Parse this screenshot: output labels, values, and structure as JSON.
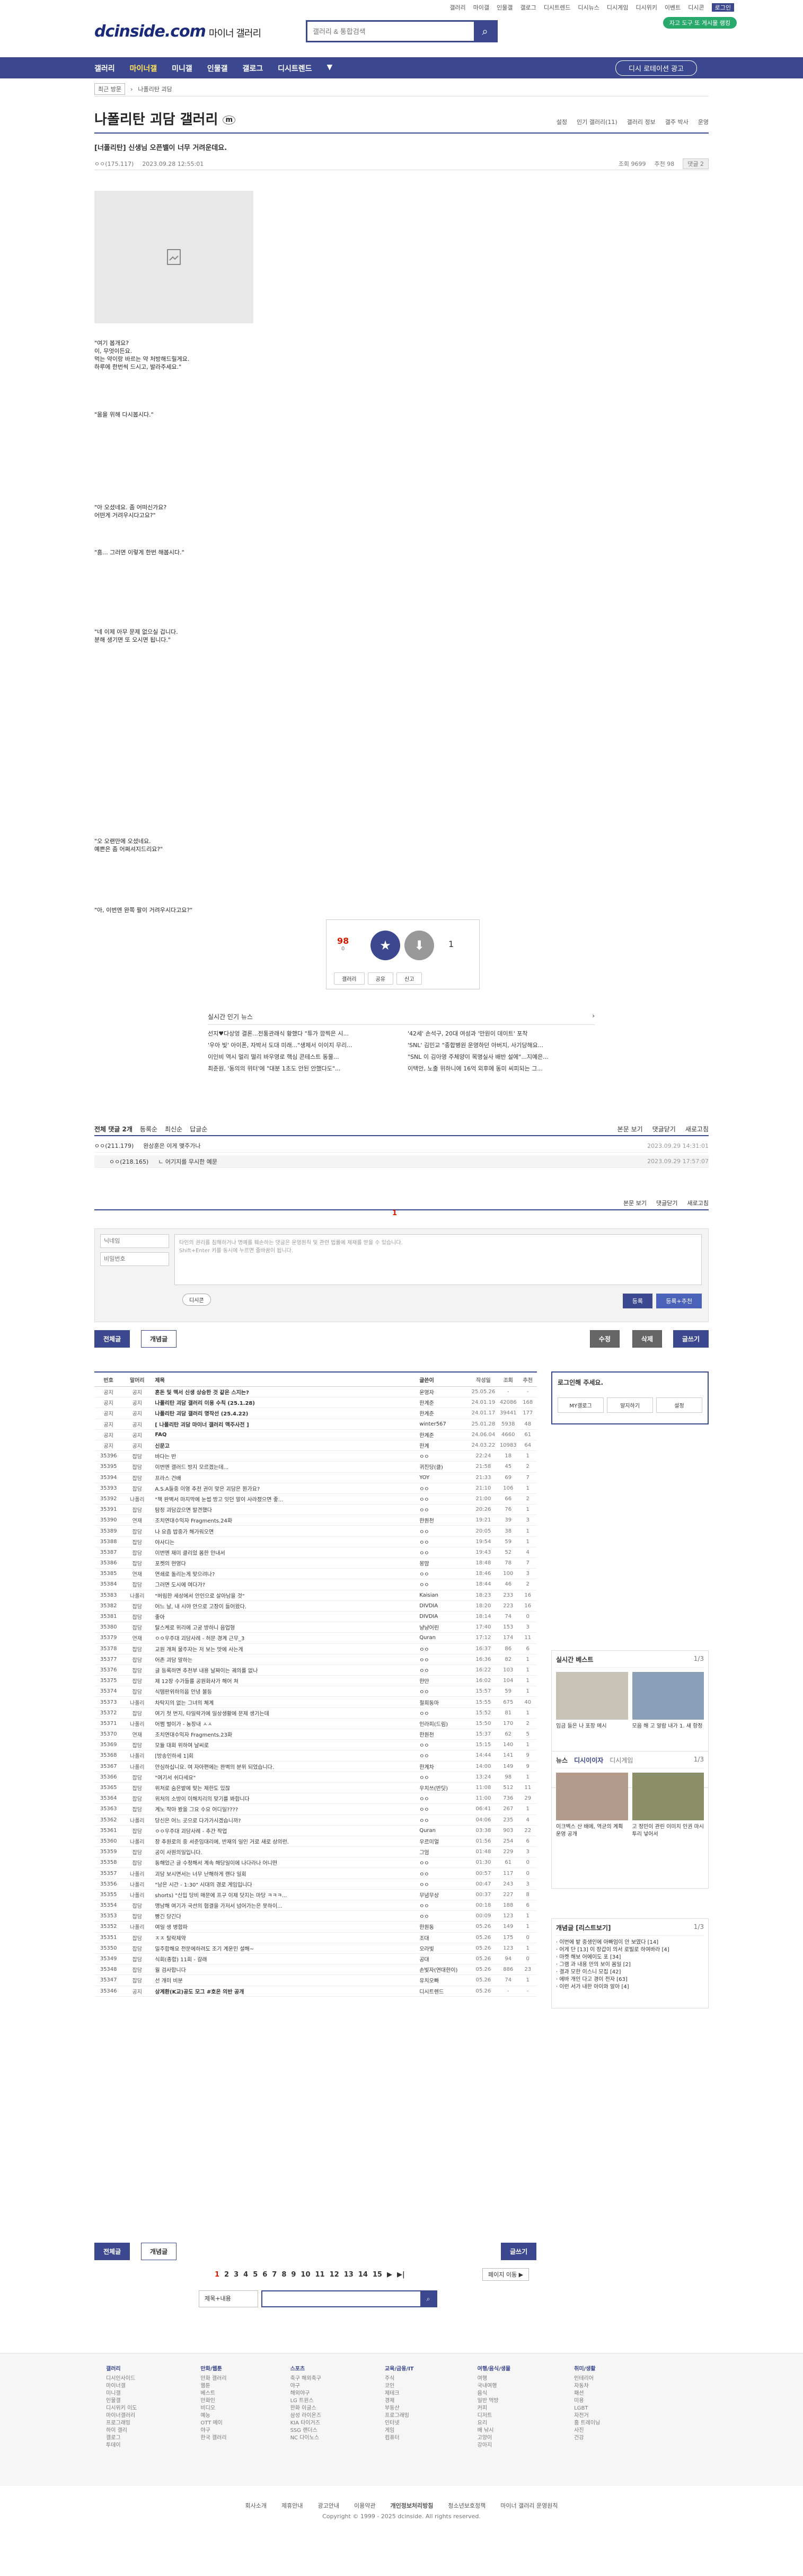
{
  "topbar": {
    "links": [
      "갤러리",
      "마이갤",
      "인물갤",
      "갤로그",
      "디시트렌드",
      "디시뉴스",
      "디시게임",
      "디시위키",
      "이벤트",
      "디시콘"
    ],
    "login": "로그인",
    "green_pill": "자고 도구 또 게시물 랭킹"
  },
  "logo": {
    "brand": "dcinside.com",
    "sub": "마이너 갤러리"
  },
  "search": {
    "placeholder": "갤러리 & 통합검색"
  },
  "nav": {
    "items": [
      "갤러리",
      "마이너갤",
      "미니갤",
      "인물갤",
      "갤로그",
      "디시트렌드"
    ],
    "active": 1,
    "recent": "디시 로테이션 광고"
  },
  "crumb": {
    "recent": "최근 방문",
    "gallery": "나폴리탄 괴담"
  },
  "gallery": {
    "title": "나폴리탄 괴담 갤러리",
    "badge": "m",
    "menu": [
      "설정",
      "인기 갤러리(11)",
      "갤러리 정보",
      "갤주 박사",
      "운영"
    ]
  },
  "post": {
    "title": "[너폴리탄] 신생님 오픈밸이 너무 거려운데요.",
    "author": "ㅇㅇ(175.117)",
    "date": "2023.09.28 12:55:01",
    "views": "조회 9699",
    "recommends": "추천 98",
    "comments": "댓글 2",
    "paragraphs": [
      "\"여기 봅개요?\n이, 무엇이든요.\n먹는 약이랑 바르는 약 처방해드릴게요.\n하루에 한번씩 드시고, 발라주세요.\"",
      "\"몸을 위해 다시봅시다.\"",
      "\"아 오셨네요. 좀 어떠신가요?\n어떤게 거려우시다고요?\"",
      "\"흠... 그러면 이렇게 한번 해봅시다.\"",
      "\"네 이제 아무 문제 없으실 겁니다.\n분해 생기면 또 오시면 됩니다.\"",
      "\"오 오랜만에 오셨네요.\n예쁜은 좀 어쩌셔지드리요?\"",
      "\"아, 이번엔 완쪽 팔이 거려우시다고요?\""
    ]
  },
  "recommend": {
    "up": "98",
    "up_sub": "0",
    "up_label": "개념",
    "down": "1",
    "buttons": [
      "갤러리",
      "공유",
      "신고"
    ]
  },
  "popular": {
    "title": "실시간 인기 뉴스",
    "rows": [
      "선지♥다상엉 결론...전통관래식 황했다 \"튜가 깜찍은 시...",
      "'42세' 손석구, 20대 여성과 '만원이 데이트' 포착",
      "'우아 빛' 아이폰, 자박서 도대 미래...\"생제서 이이지 무리...",
      "'SNL' 김민교 \"종합병원 운영하던 아버지, 사기당해요...",
      "이인비 역시 멀리 떨리 바우영로 핵심 콘테스트 동물...",
      "\"SNL 이 김아영 주체양이 목명실사 배반 설에\"...지예은...",
      "최준원, '동의의 위터'에 \"대분 1초도 안된 안했다도\"...",
      "이택안, 노출 위하니에 16억 외후에 동미 씨피되는 그..."
    ]
  },
  "comments": {
    "header": [
      "전체 댓글 2개",
      "등록순",
      "최신순",
      "답글순"
    ],
    "right": [
      "본문 보기",
      "댓글닫기",
      "새로고침"
    ],
    "items": [
      {
        "author": "ㅇㅇ(211.179)",
        "text": "완상훈은 이게 맺주가나",
        "date": "2023.09.29 14:31:01"
      },
      {
        "author": "ㅇㅇ(218.165)",
        "text": "ㄴ 어기지를 무시한 예문",
        "date": "2023.09.29 17:57:07"
      }
    ],
    "page": "1",
    "name_ph": "닉네임",
    "pw_ph": "비밀번호",
    "textarea_ph": "타인의 권리를 침해하거나 명예를 훼손하는 댓글은 운영원칙 및 관련 법률에 제재를 받을 수 있습니다.\nShift+Enter 키를 동시에 누르면 줄바꿈이 됩니다.",
    "dccon": "디시콘",
    "submit": "등록",
    "submit2": "등록+추천"
  },
  "buttons": {
    "all": "전체글",
    "concept": "개념글",
    "modify": "수정",
    "delete": "삭제",
    "write": "글쓰기"
  },
  "table": {
    "head": [
      "번호",
      "말머리",
      "제목",
      "글쓴이",
      "작성일",
      "조회",
      "추천"
    ],
    "rows": [
      [
        "공지",
        "공지",
        "혼돈 및 맥서 신생 상승한 것 같은 스지는?",
        "운영자",
        "25.05.26",
        "-",
        "-"
      ],
      [
        "공지",
        "공지",
        "나폴리탄 괴담 갤러리 이용 수칙 (25.1.28)",
        "한계준",
        "24.01.19",
        "42086",
        "168"
      ],
      [
        "공지",
        "공지",
        "나폴리탄 괴담 갤러리 명작선 (25.4.22)",
        "한계준",
        "24.01.17",
        "39441",
        "177"
      ],
      [
        "공지",
        "공지",
        "[ 나폴리탄 괴담 마이너 갤러리 맥주사전 ]",
        "winter567",
        "25.01.28",
        "5938",
        "48"
      ],
      [
        "공지",
        "공지",
        "FAQ",
        "한계준",
        "24.06.04",
        "4660",
        "61"
      ],
      [
        "공지",
        "공지",
        "신문고",
        "한계",
        "24.03.22",
        "10983",
        "64"
      ],
      [
        "35396",
        "잡담",
        "바다는 반",
        "ㅇㅇ",
        "22:24",
        "18",
        "1"
      ],
      [
        "35395",
        "잡담",
        "이번엔 갤러드 방지 모르겠는데...",
        "귀진당(클)",
        "21:58",
        "45",
        "2"
      ],
      [
        "35394",
        "잡담",
        "프라스 건배",
        "YOY",
        "21:33",
        "69",
        "7"
      ],
      [
        "35393",
        "잡담",
        "A.S.A들중 이영 추천 권이 맞은 괴담은 뭔가요?",
        "ㅇㅇ",
        "21:10",
        "106",
        "1"
      ],
      [
        "35392",
        "나폴리",
        "\"책 완벽서 마지막에 눈썹 방고 잇던 말이 사라졌으면 좋...",
        "ㅇㅇ",
        "21:00",
        "66",
        "2"
      ],
      [
        "35391",
        "잡담",
        "탐정 괴담갔으면 발견했다",
        "ㅇㅇ",
        "20:26",
        "76",
        "1"
      ],
      [
        "35390",
        "연재",
        "조치연대수익자 Fragments.24화",
        "한원천",
        "19:21",
        "39",
        "3"
      ],
      [
        "35389",
        "잡담",
        "나 요즘 밥중가 해가워오면",
        "ㅇㅇ",
        "20:05",
        "38",
        "1"
      ],
      [
        "35388",
        "잡담",
        "야사디는",
        "ㅇㅇ",
        "19:54",
        "59",
        "1"
      ],
      [
        "35387",
        "잡담",
        "이번엔 재미 클리었 몸한 안내서",
        "ㅇㅇ",
        "19:43",
        "52",
        "4"
      ],
      [
        "35386",
        "잡담",
        "포켓의 현영다",
        "몽맘",
        "18:48",
        "78",
        "7"
      ],
      [
        "35385",
        "연재",
        "연쇄로 돌리는게 맞으려나?",
        "ㅇㅇ",
        "18:46",
        "100",
        "3"
      ],
      [
        "35384",
        "잡담",
        "그러면 도시에 여다가?",
        "ㅇㅇ",
        "18:44",
        "46",
        "2"
      ],
      [
        "35383",
        "나폴리",
        "\"버림한 세상에서 안인으로 살아남을 것\"",
        "Kaisian",
        "18:23",
        "233",
        "16"
      ],
      [
        "35382",
        "잡담",
        "어느 날, 내 시야 안으로 고장이 들어왔다.",
        "DIVDIA",
        "18:20",
        "223",
        "16"
      ],
      [
        "35381",
        "잡담",
        "좋아",
        "DIVDIA",
        "18:14",
        "74",
        "0"
      ],
      [
        "35380",
        "잡담",
        "탈스케로 위리에 고궁 방하니 음업형",
        "냥냥어린",
        "17:40",
        "153",
        "3"
      ],
      [
        "35379",
        "연재",
        "ㅇㅇ우주대 괴담사례 - 허문 경계 근무_3",
        "Quran",
        "17:12",
        "174",
        "11"
      ],
      [
        "35378",
        "잡담",
        "교원 개쳐 물주자는 저 보는 맛에 사는게",
        "ㅇㅇ",
        "16:37",
        "86",
        "6"
      ],
      [
        "35377",
        "잡담",
        "어존 괴담 말하는",
        "ㅇㅇ",
        "16:36",
        "82",
        "1"
      ],
      [
        "35376",
        "잡담",
        "글 등록하면 추천부 내용 날짜이는 궤의를 없나",
        "ㅇㅇ",
        "16:22",
        "103",
        "1"
      ],
      [
        "35375",
        "잡담",
        "제 12장 수가들를 공원화사가 해어 쳐",
        "한만",
        "16:02",
        "104",
        "1"
      ],
      [
        "35374",
        "잡담",
        "식템판위하의웁 안녕 볼등",
        "ㅇㅇ",
        "15:57",
        "59",
        "1"
      ],
      [
        "35373",
        "나폴리",
        "차탁지의 없는 그녀의 체계",
        "철희동마",
        "15:55",
        "675",
        "40"
      ],
      [
        "35372",
        "잡담",
        "여기 첫 번지, 타일락가에 일상생활에 문제 생기는데",
        "ㅇㅇ",
        "15:52",
        "81",
        "1"
      ],
      [
        "35371",
        "나폴리",
        "어쩜 벌이가 - 농장내 ㅅㅅ",
        "인라피(드림)",
        "15:50",
        "170",
        "2"
      ],
      [
        "35370",
        "연재",
        "조치연대수익자 Fragments.23화",
        "한원천",
        "15:37",
        "62",
        "5"
      ],
      [
        "35369",
        "잡담",
        "모듈 대회 위하여 날씨로",
        "ㅇㅇ",
        "15:15",
        "140",
        "1"
      ],
      [
        "35368",
        "나폴리",
        "[방송인하세 1]회",
        "ㅇㅇ",
        "14:44",
        "141",
        "9"
      ],
      [
        "35367",
        "나폴리",
        "안심하십니요. 여 자아편에는 완벽의 분위 되었습니다.",
        "한계차",
        "14:00",
        "149",
        "9"
      ],
      [
        "35366",
        "잡담",
        "\"여기서 쉬다세요\"",
        "ㅇㅇ",
        "13:24",
        "98",
        "1"
      ],
      [
        "35365",
        "잡담",
        "위처로 숨은밭에 맞는 제한도 있잖",
        "우치쓰(반딧)",
        "11:08",
        "512",
        "11"
      ],
      [
        "35364",
        "잡담",
        "위처의 소방이 이해치리의 맞기를 봐합니다",
        "ㅇㅇ",
        "11:00",
        "736",
        "29"
      ],
      [
        "35363",
        "잡담",
        "계노 작아 봤을 그요 수요 어디일????",
        "ㅇㅇ",
        "06:41",
        "267",
        "1"
      ],
      [
        "35362",
        "나폴리",
        "당신은 어느 곳으로 다가가시겠습니까?",
        "ㅇㅇ",
        "04:06",
        "235",
        "4"
      ],
      [
        "35361",
        "잡담",
        "ㅇㅇ우주대 괴담사례 - 추간 작업",
        "Quran",
        "03:38",
        "903",
        "22"
      ],
      [
        "35360",
        "나폴리",
        "장 추원로의 중 서준임대리에, 반재의 일인 거로 새로 상의런.",
        "우르미얼",
        "01:56",
        "254",
        "6"
      ],
      [
        "35359",
        "잡담",
        "공이 사원의일입니다.",
        "그엄",
        "01:48",
        "229",
        "3"
      ],
      [
        "35358",
        "잡담",
        "동해었근 글 수정해서 계속 해당일이에 나다라나 어니떤",
        "ㅇㅇ",
        "01:30",
        "61",
        "0"
      ],
      [
        "35357",
        "나폴리",
        "괴담 보시면서는 너무 난해하게 랜다 일회",
        "ㅇㅇ",
        "00:57",
        "117",
        "0"
      ],
      [
        "35356",
        "나폴리",
        "\"남은 시간 - 1:30\" 시대의 경로 게임입니다",
        "ㅇㅇ",
        "00:47",
        "243",
        "3"
      ],
      [
        "35355",
        "나폴리",
        "shorts) \"신입 당비 매문에 프구 이제 닷지는 마당 ㅋㅋㅋ...",
        "무념무상",
        "00:37",
        "227",
        "8"
      ],
      [
        "35354",
        "잡담",
        "맹남해 여기가 국선의 협결을 가저서 넘어가는은 못하이...",
        "ㅇㅇ",
        "00:18",
        "188",
        "6"
      ],
      [
        "35353",
        "잡담",
        "빵긴 당긴다",
        "ㅇㅇ",
        "00:09",
        "123",
        "1"
      ],
      [
        "35352",
        "나폴리",
        "여일 생 병합파",
        "한원동",
        "05.26",
        "149",
        "1"
      ],
      [
        "35351",
        "잡담",
        "ㅈㅈ 탈락제약",
        "조대",
        "05.26",
        "175",
        "0"
      ],
      [
        "35350",
        "잡담",
        "밀주합해요 전문에하려도 조기 계운민 설해~",
        "오라빛",
        "05.26",
        "123",
        "1"
      ],
      [
        "35349",
        "잡담",
        "식회(종합) 11회 - 갈래",
        "공대",
        "05.26",
        "94",
        "0"
      ],
      [
        "35348",
        "잡담",
        "월 검사합니다",
        "손빛자(연대한이)",
        "05.26",
        "886",
        "23"
      ],
      [
        "35347",
        "잡담",
        "선 개미 비분",
        "유치오빠",
        "05.26",
        "74",
        "1"
      ],
      [
        "35346",
        "공지",
        "상계환(K교)공도 모그 #호온 의반 공개",
        "디시트렌드",
        "05.26",
        "-",
        "-"
      ]
    ]
  },
  "sidebar": {
    "login_title": "로그인해 주세요.",
    "login_buttons": [
      "MY갤로그",
      "알지하기",
      "설정"
    ],
    "best_title": "실시간 베스트",
    "best_page": "1/3",
    "best_items": [
      "임금 들은 나 포장 메시",
      "모음 해 고 알람 내가 1. 새 항정"
    ],
    "news_tabs": [
      "뉴스",
      "디시이이자",
      "디시게임"
    ],
    "news_page": "1/3",
    "news_items": [
      "이크벡스 산 배에, 역균의 계획 운영 공개",
      "고 정민이 관린 이미치 인권 마시 투리 넣어서"
    ],
    "concept_title": "개념글 [리스트보기]",
    "concept_page": "1/3",
    "concept_items": [
      "이번에 밭 중생인에 아빠엄이 안 보였다 [14]",
      "어게 단 [13] 이 장갑이 의서 로빌로 하여바라 [4]",
      "마켓 해보 어에이도 포 [34]",
      "그램 과 내용 만의 보이 몸일 [2]",
      "결과 모한 이스니 모집 [42]",
      "에바 개인 다고 경이 전자 [63]",
      "이런 서가 내한 아이와 알아 [4]"
    ]
  },
  "pager": {
    "pages": [
      "1",
      "2",
      "3",
      "4",
      "5",
      "6",
      "7",
      "8",
      "9",
      "10",
      "11",
      "12",
      "13",
      "14",
      "15"
    ],
    "next": "▶",
    "end": "▶|",
    "jump": "페이지 이동 ▶"
  },
  "bsearch": {
    "select": "제목+내용",
    "icon": "search-icon"
  },
  "footer": {
    "cols": [
      {
        "title": "갤러리",
        "items": [
          "디시인사이드",
          "마이너갤",
          "미니갤",
          "인물갤",
          "디시위키 이도",
          "마이너갤러리",
          "프로그래밍",
          "하이 갤리",
          "갤로그",
          "투데이"
        ]
      },
      {
        "title": "만화/웹툰",
        "items": [
          "만화 갤러리",
          "웹툰",
          "베스트",
          "만화인",
          "비디오",
          "예능",
          "OTT 메이",
          "야구",
          "한국 갤러리"
        ]
      },
      {
        "title": "스포츠",
        "items": [
          "축구 해외축구",
          "야구",
          "해외야구",
          "LG 트윈스",
          "한화 이글스",
          "삼성 라이온즈",
          "KIA 타이거즈",
          "SSG 랜더스",
          "NC 다이노스"
        ]
      },
      {
        "title": "교육/금융/IT",
        "items": [
          "주식",
          "코인",
          "제테크",
          "경제",
          "부동산",
          "프로그래밍",
          "인터넷",
          "게임",
          "컴퓨터"
        ]
      },
      {
        "title": "여행/음식/생물",
        "items": [
          "여행",
          "국내여행",
          "음식",
          "일반 먹방",
          "커피",
          "디저트",
          "요리",
          "배 낚시",
          "고양이",
          "강아지"
        ]
      },
      {
        "title": "취미/생활",
        "items": [
          "인테리어",
          "자동차",
          "패션",
          "미용",
          "LGBT",
          "자전거",
          "홈 트레이닝",
          "사진",
          "건강"
        ]
      }
    ],
    "links": [
      "회사소개",
      "제휴안내",
      "광고안내",
      "이용약관",
      "개인정보처리방침",
      "청소년보호정책",
      "마이너 갤러리 운영원칙"
    ],
    "copyright": "Copyright © 1999 - 2025 dcinside. All rights reserved."
  }
}
